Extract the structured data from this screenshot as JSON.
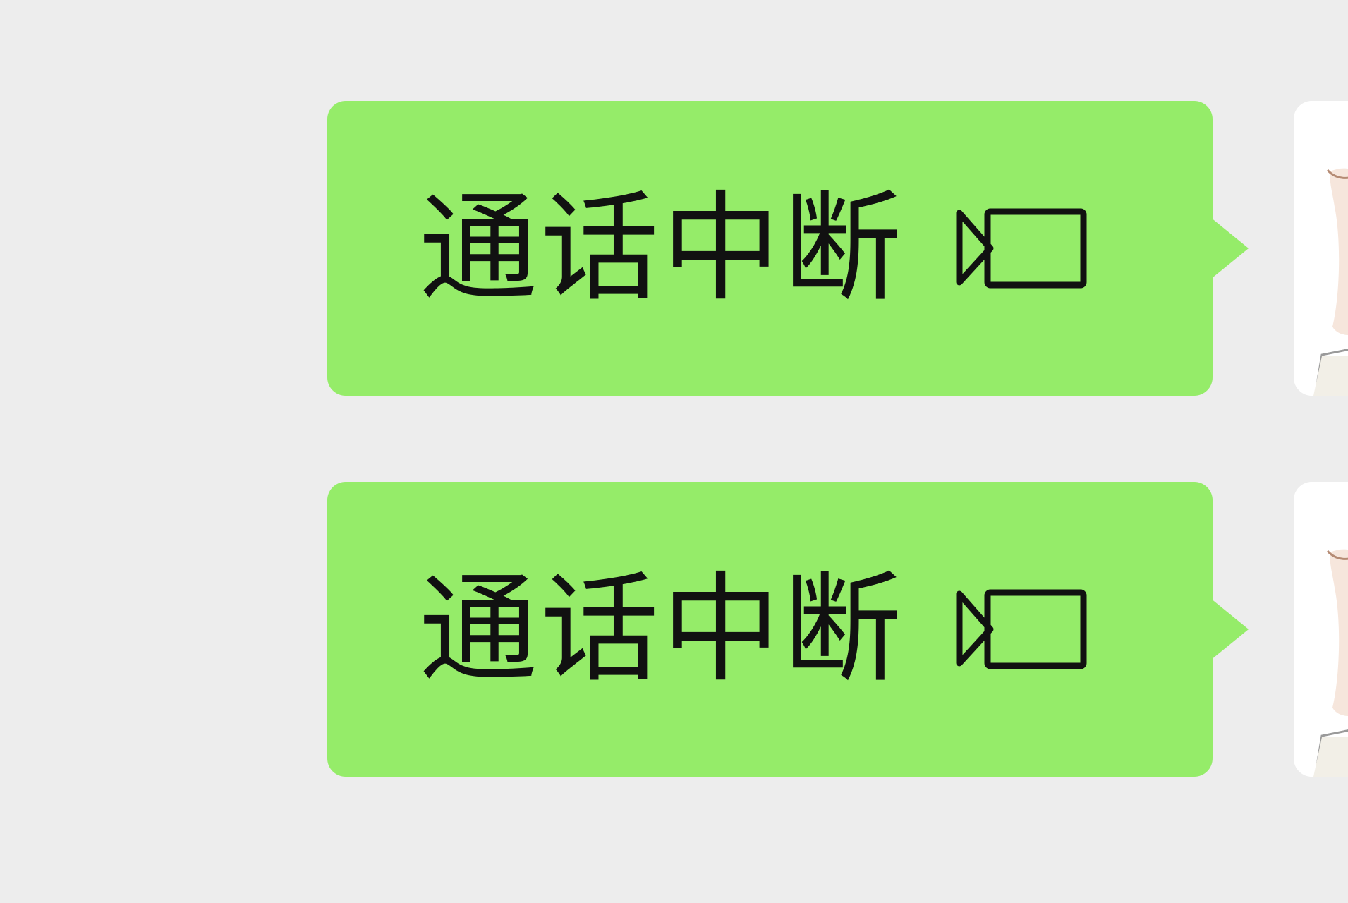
{
  "chat": {
    "background_color": "#ededed",
    "bubble_color": "#95ec69",
    "messages": [
      {
        "text": "通话中断",
        "icon": "video-camera-icon",
        "sender": "self"
      },
      {
        "text": "通话中断",
        "icon": "video-camera-icon",
        "sender": "self"
      }
    ]
  }
}
